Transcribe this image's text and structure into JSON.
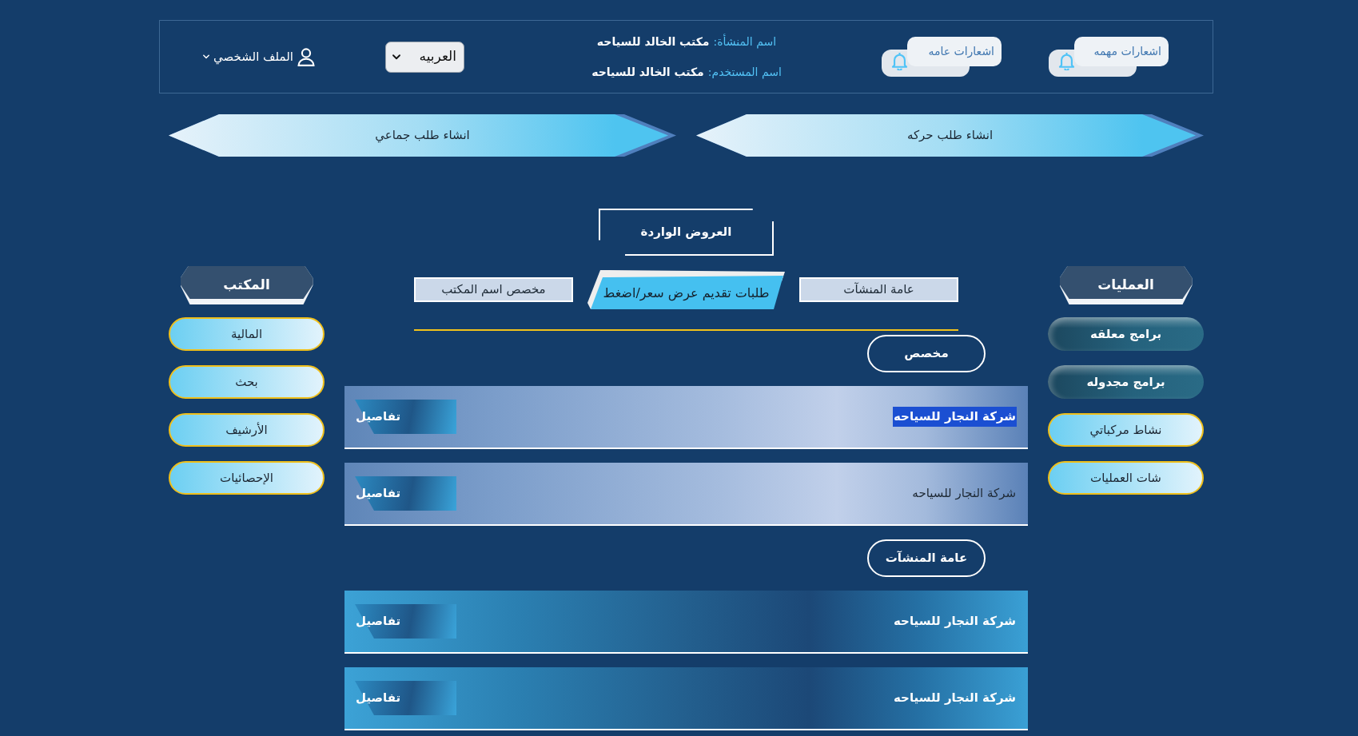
{
  "header": {
    "notifications": [
      {
        "label": "اشعارات مهمه"
      },
      {
        "label": "اشعارات عامه"
      }
    ],
    "facility": {
      "label": "اسم المنشأة:",
      "value": "مكتب الخالد للسياحه"
    },
    "user": {
      "label": "اسم المستخدم:",
      "value": "مكتب الخالد للسياحه"
    },
    "language": {
      "value": "العربيه"
    },
    "profile": {
      "label": "الملف الشخصي"
    }
  },
  "actions": [
    {
      "label": "انشاء طلب حركه"
    },
    {
      "label": "انشاء طلب جماعي"
    }
  ],
  "operations_menu": {
    "title": "العمليات",
    "items": [
      {
        "label": "برامج معلقه",
        "kind": "dark"
      },
      {
        "label": "برامج مجدوله",
        "kind": "dark"
      },
      {
        "label": "نشاط مركباتي",
        "kind": "light"
      },
      {
        "label": "شات العمليات",
        "kind": "light"
      }
    ]
  },
  "offers": {
    "title": "العروض الواردة",
    "tabs": [
      {
        "label": "عامة المنشآت",
        "selected": false
      },
      {
        "label": "طلبات تقديم عرض سعر/اضغط",
        "selected": true
      },
      {
        "label": "مخصص اسم المكتب",
        "selected": false
      }
    ],
    "groups": [
      {
        "label": "مخصص",
        "kind": "light",
        "rows": [
          {
            "name": "شركة النجار للسياحه",
            "highlighted": true,
            "action": "تفاصيل"
          },
          {
            "name": "شركة النجار للسياحه",
            "highlighted": false,
            "action": "تفاصيل"
          }
        ]
      },
      {
        "label": "عامة المنشآت",
        "kind": "dark",
        "rows": [
          {
            "name": "شركة النجار للسياحه",
            "highlighted": false,
            "action": "تفاصيل"
          },
          {
            "name": "شركة النجار للسياحه",
            "highlighted": false,
            "action": "تفاصيل"
          }
        ]
      }
    ]
  },
  "office_menu": {
    "title": "المكتب",
    "items": [
      {
        "label": "المالية",
        "kind": "light"
      },
      {
        "label": "بحث",
        "kind": "light"
      },
      {
        "label": "الأرشيف",
        "kind": "light"
      },
      {
        "label": "الإحصائيات",
        "kind": "light"
      }
    ]
  }
}
